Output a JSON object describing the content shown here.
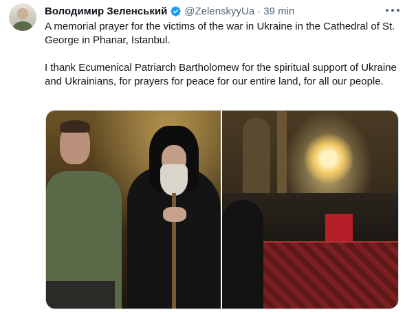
{
  "tweet": {
    "author_name": "Володимир Зеленський",
    "handle": "@ZelenskyyUa",
    "separator": "·",
    "time": "39 min",
    "paragraphs": [
      "A memorial prayer for the victims of the war in Ukraine in the Cathedral of St. George in Phanar, Istanbul.",
      "I thank Ecumenical Patriarch Bartholomew for the spiritual support of Ukraine and Ukrainians, for prayers for peace for our entire land, for all our people."
    ],
    "verified_icon": "verified-badge-icon",
    "more_icon": "more-options-icon",
    "colors": {
      "name": "#0f1419",
      "meta": "#536471",
      "verified": "#1d9bf0",
      "border": "#cfd9de"
    }
  }
}
